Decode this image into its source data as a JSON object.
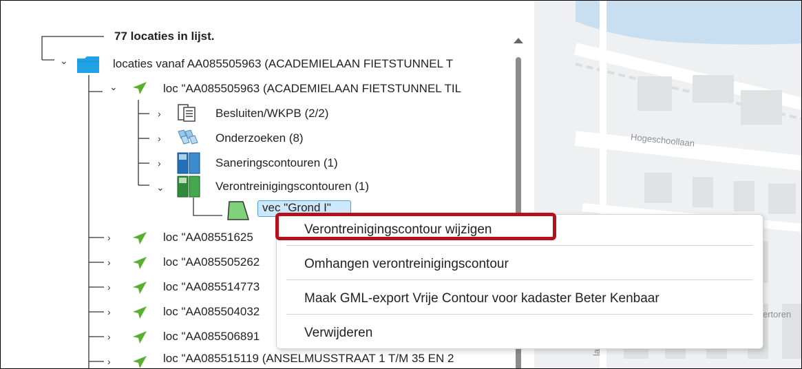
{
  "tree": {
    "header": "77 locaties in lijst.",
    "root_label": "locaties vanaf AA085505963 (ACADEMIELAAN FIETSTUNNEL T",
    "loc_main_label": "loc \"AA085505963 (ACADEMIELAAN FIETSTUNNEL TIL",
    "children": [
      {
        "label": "Besluiten/WKPB (2/2)",
        "icon": "document-icon"
      },
      {
        "label": "Onderzoeken (8)",
        "icon": "research-icon"
      },
      {
        "label": "Saneringscontouren (1)",
        "icon": "remediation-contour-icon"
      },
      {
        "label": "Verontreinigingscontouren (1)",
        "icon": "pollution-contour-icon"
      }
    ],
    "selected_node": "vec \"Grond I\"",
    "other_locs": [
      "loc \"AA08551625",
      "loc \"AA085505262",
      "loc \"AA085514773",
      "loc \"AA085504032",
      "loc \"AA085506891",
      "loc \"AA085515119 (ANSELMUSSTRAAT 1 T/M 35 EN 2"
    ]
  },
  "context_menu": {
    "items": [
      "Verontreinigingscontour wijzigen",
      "Omhangen verontreinigingscontour",
      "Maak GML-export Vrije Contour voor kadaster Beter Kenbaar",
      "Verwijderen"
    ],
    "highlight_color": "#b4111c"
  },
  "map": {
    "street_label_1": "Hogeschoollaan",
    "street_label_2": "ertoren",
    "street_label_3": "laa"
  },
  "colors": {
    "folder": "#1fa3e6",
    "location_pin": "#5ab02e",
    "selection": "#cde8fb"
  }
}
